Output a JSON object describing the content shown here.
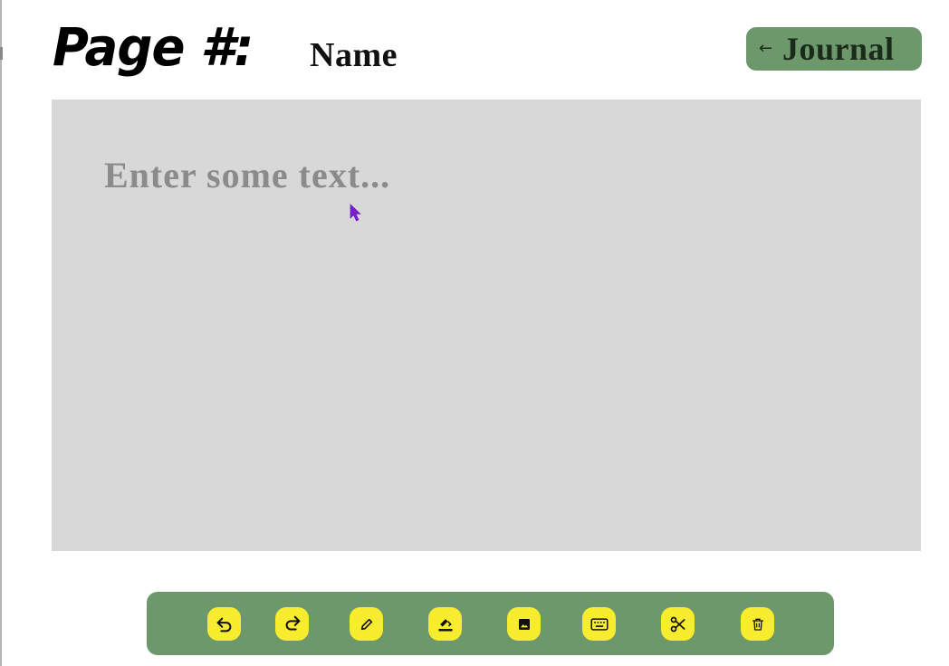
{
  "header": {
    "page_label": "Page #:",
    "page_name": "Name"
  },
  "nav": {
    "back_arrow": "←",
    "journal_label": "Journal"
  },
  "editor": {
    "placeholder": "Enter some text...",
    "value": ""
  },
  "toolbar": {
    "tools": [
      {
        "name": "undo",
        "icon": "undo-icon"
      },
      {
        "name": "redo",
        "icon": "redo-icon"
      },
      {
        "name": "pencil",
        "icon": "pencil-icon"
      },
      {
        "name": "highlighter",
        "icon": "highlighter-icon"
      },
      {
        "name": "image",
        "icon": "image-icon"
      },
      {
        "name": "keyboard",
        "icon": "keyboard-icon"
      },
      {
        "name": "scissors",
        "icon": "scissors-icon"
      },
      {
        "name": "delete",
        "icon": "trash-icon"
      }
    ]
  },
  "colors": {
    "accent_green": "#6c986b",
    "tool_yellow": "#f7ec2e",
    "editor_bg": "#d8d8d8",
    "placeholder_gray": "#8b8b8b",
    "cursor_purple": "#7a1fd1"
  }
}
